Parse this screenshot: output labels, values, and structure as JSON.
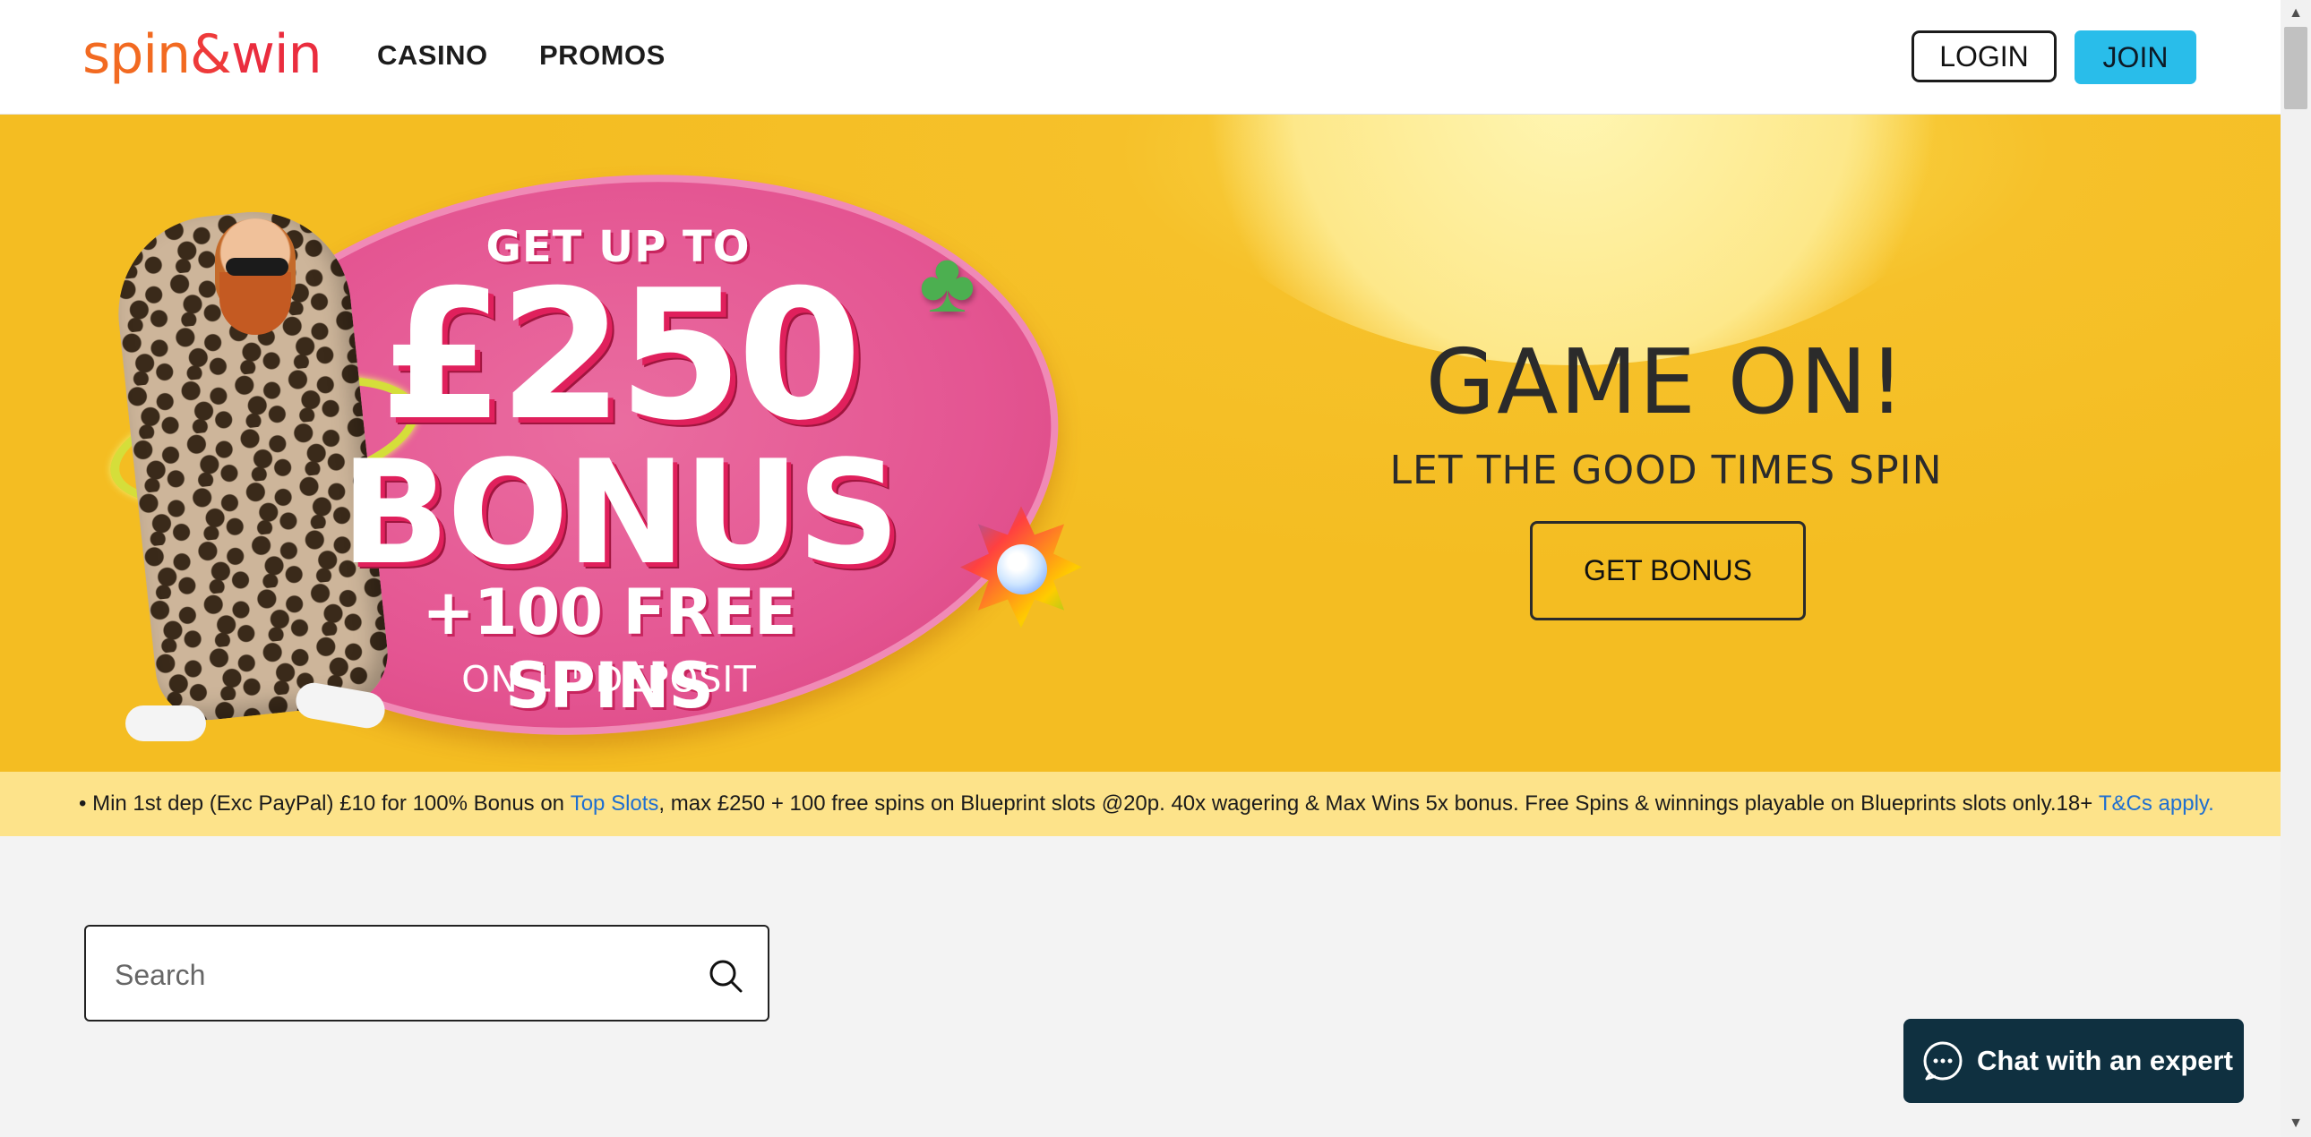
{
  "brand": {
    "logo_part1": "spin",
    "logo_amp": "&",
    "logo_part2": "win"
  },
  "nav": {
    "items": [
      {
        "label": "CASINO"
      },
      {
        "label": "PROMOS"
      }
    ]
  },
  "header_actions": {
    "login_label": "LOGIN",
    "join_label": "JOIN"
  },
  "hero": {
    "promo": {
      "line1": "GET UP TO",
      "amount": "£250",
      "bonus": "BONUS",
      "spins": "+100 FREE SPINS",
      "deposit_prefix": "ON 1",
      "deposit_sup": "ST",
      "deposit_suffix": " DEPOSIT"
    },
    "title": "GAME ON!",
    "subtitle": "LET THE GOOD TIMES SPIN",
    "cta_label": "GET BONUS"
  },
  "terms": {
    "prefix": "• Min 1st dep (Exc PayPal) £10 for 100% Bonus on ",
    "top_slots_link": "Top Slots",
    "middle": ", max £250 + 100 free spins on Blueprint slots @20p. 40x wagering & Max Wins 5x bonus. Free Spins & winnings playable on Blueprints slots only.18+ ",
    "tcs_link": "T&Cs apply."
  },
  "search": {
    "placeholder": "Search",
    "value": ""
  },
  "chat": {
    "label": "Chat with an expert"
  },
  "colors": {
    "brand_orange": "#f26a21",
    "brand_red": "#ea2d3e",
    "join_blue": "#29bdea",
    "hero_yellow": "#f6c12a",
    "terms_bg": "#fde38a",
    "link_blue": "#1f6fd1",
    "chat_bg": "#0f3040"
  },
  "icons": {
    "search": "search-icon",
    "chat": "chat-bubble-icon",
    "scroll_up": "scroll-up-arrow-icon",
    "scroll_down": "scroll-down-arrow-icon"
  }
}
